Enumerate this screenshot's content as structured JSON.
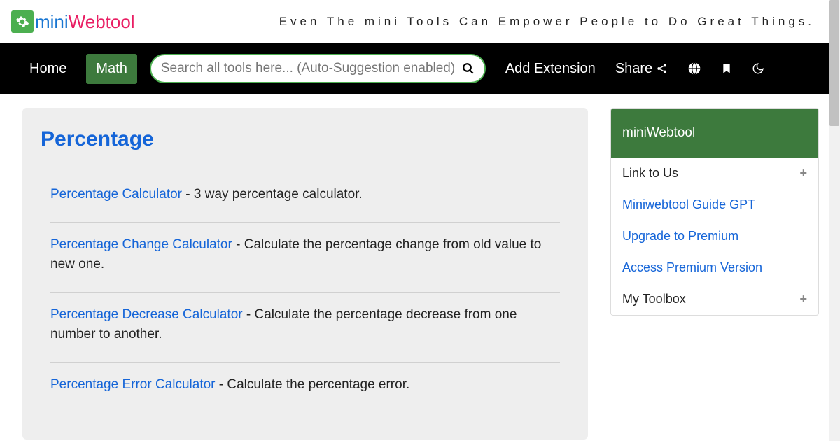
{
  "logo": {
    "mini": "mini",
    "web": "Webtool"
  },
  "tagline": "Even The mini Tools Can Empower People to Do Great Things.",
  "nav": {
    "home": "Home",
    "math": "Math",
    "search_placeholder": "Search all tools here... (Auto-Suggestion enabled)",
    "add_extension": "Add Extension",
    "share": "Share"
  },
  "page": {
    "title": "Percentage"
  },
  "tools": [
    {
      "name": "Percentage Calculator",
      "desc": " - 3 way percentage calculator."
    },
    {
      "name": "Percentage Change Calculator",
      "desc": " - Calculate the percentage change from old value to new one."
    },
    {
      "name": "Percentage Decrease Calculator",
      "desc": " - Calculate the percentage decrease from one number to another."
    },
    {
      "name": "Percentage Error Calculator",
      "desc": " - Calculate the percentage error."
    }
  ],
  "sidebar": {
    "title": "miniWebtool",
    "link_to_us": "Link to Us",
    "guide_gpt": "Miniwebtool Guide GPT",
    "upgrade": "Upgrade to Premium",
    "access_premium": "Access Premium Version",
    "my_toolbox": "My Toolbox",
    "plus": "+"
  }
}
